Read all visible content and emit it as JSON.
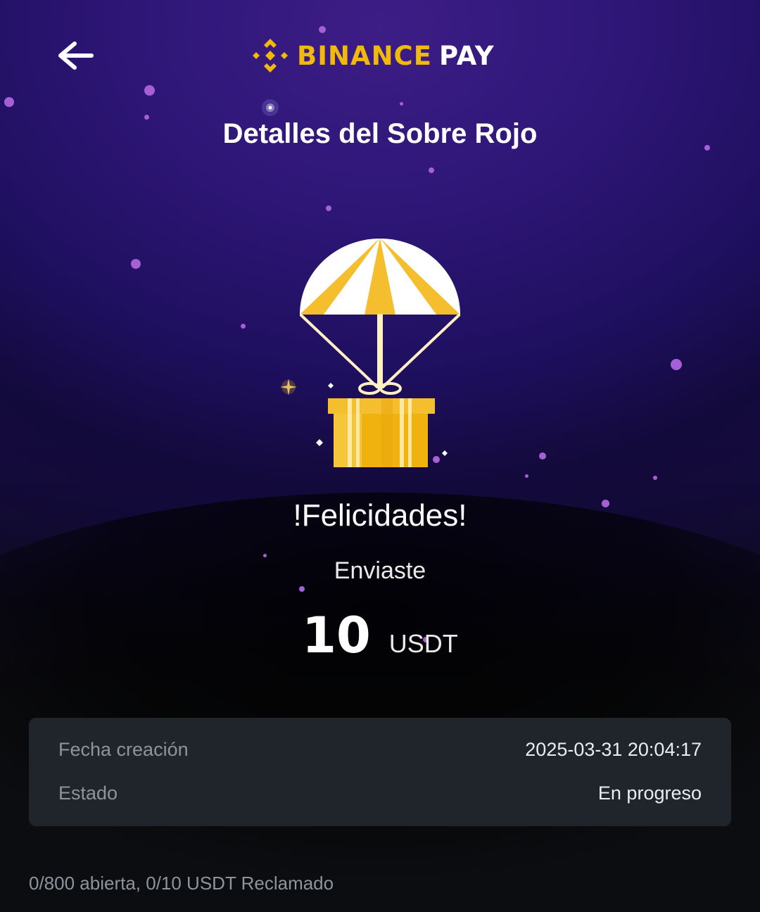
{
  "header": {
    "back_icon": "arrow-left-icon",
    "logo_icon": "binance-diamond-icon",
    "logo_brand": "BINANCE",
    "logo_product": "PAY",
    "title": "Detalles del Sobre Rojo"
  },
  "hero": {
    "illustration": "parachute-gift-icon",
    "congrats": "!Felicidades!",
    "sent_label": "Enviaste",
    "amount": "10",
    "currency": "USDT"
  },
  "details": {
    "rows": [
      {
        "label": "Fecha creación",
        "value": "2025-03-31 20:04:17"
      },
      {
        "label": "Estado",
        "value": "En progreso"
      }
    ]
  },
  "footer": {
    "summary": "0/800 abierta, 0/10 USDT Reclamado"
  },
  "colors": {
    "brand_yellow": "#F0B90B",
    "hero_purple": "#2D1676",
    "card_bg": "#20242B",
    "page_bg": "#0C0D10",
    "muted_text": "#8E949C"
  }
}
